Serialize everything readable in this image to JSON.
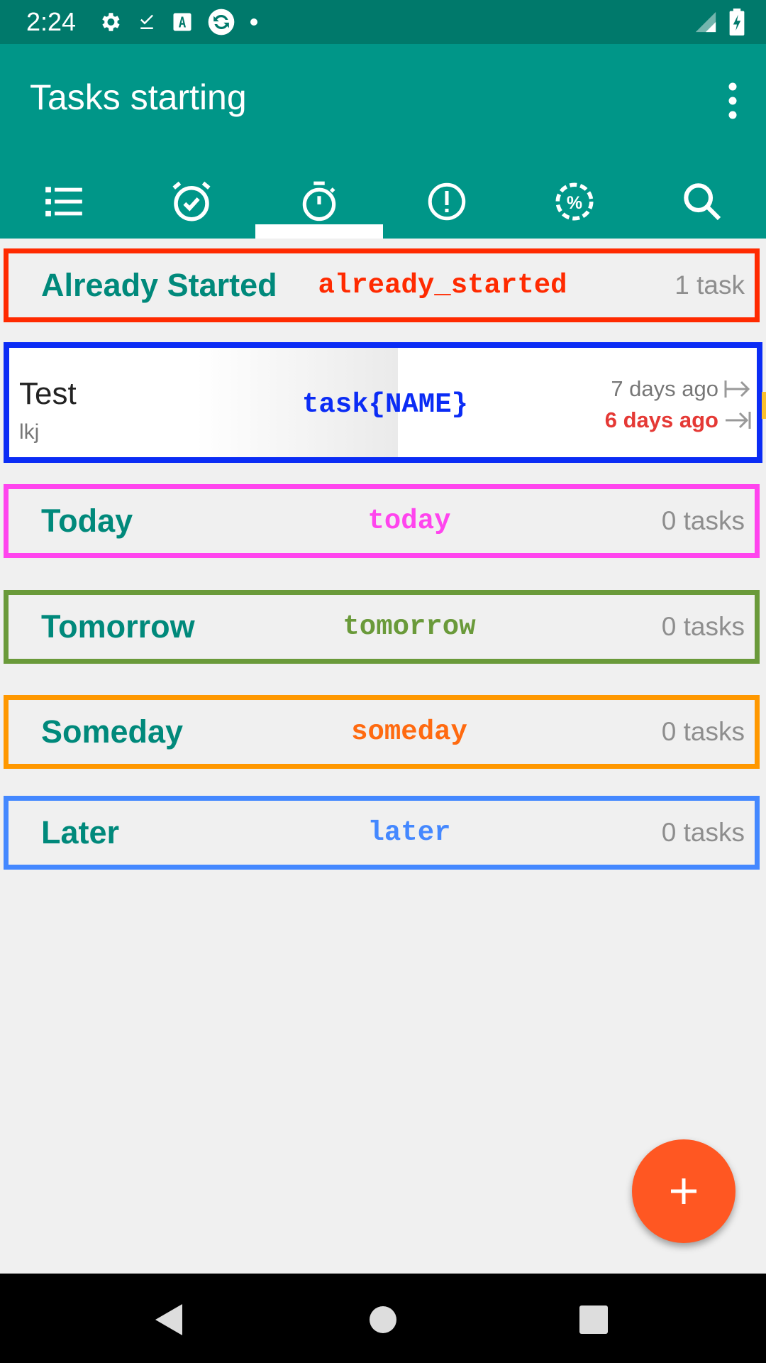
{
  "status_bar": {
    "time": "2:24"
  },
  "app_bar": {
    "title": "Tasks starting"
  },
  "tabs": [
    {
      "icon": "list-icon"
    },
    {
      "icon": "alarm-check-icon"
    },
    {
      "icon": "stopwatch-icon",
      "selected": true
    },
    {
      "icon": "alert-circle-icon"
    },
    {
      "icon": "progress-percent-icon"
    },
    {
      "icon": "search-icon"
    }
  ],
  "sections": [
    {
      "title": "Already Started",
      "tag": "already_started",
      "count": "1 task",
      "border_color": "#ff2a00",
      "tag_color": "#ff2a00"
    },
    {
      "title": "Today",
      "tag": "today",
      "count": "0 tasks",
      "border_color": "#ff44ee",
      "tag_color": "#ff44ee"
    },
    {
      "title": "Tomorrow",
      "tag": "tomorrow",
      "count": "0 tasks",
      "border_color": "#6a9a3a",
      "tag_color": "#6a9a3a"
    },
    {
      "title": "Someday",
      "tag": "someday",
      "count": "0 tasks",
      "border_color": "#ff9800",
      "tag_color": "#ff6a10"
    },
    {
      "title": "Later",
      "tag": "later",
      "count": "0 tasks",
      "border_color": "#4488ff",
      "tag_color": "#4488ff"
    }
  ],
  "task": {
    "name": "Test",
    "note": "lkj",
    "tag": "task{NAME}",
    "start": "7 days ago",
    "due": "6 days ago"
  },
  "colors": {
    "status_bar": "#00796b",
    "app_bar": "#009688",
    "section_title": "#00897b",
    "fab": "#ff5722",
    "overdue": "#e53935"
  }
}
